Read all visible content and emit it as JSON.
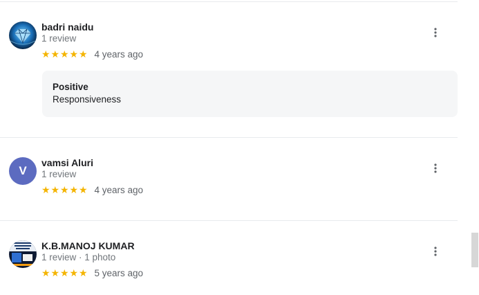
{
  "reviews": [
    {
      "name": "badri naidu",
      "meta": "1 review",
      "rating": 5,
      "time": "4 years ago",
      "avatar_type": "photo",
      "highlight": {
        "title": "Positive",
        "value": "Responsiveness"
      }
    },
    {
      "name": "vamsi Aluri",
      "meta": "1 review",
      "rating": 5,
      "time": "4 years ago",
      "avatar_type": "letter",
      "avatar_letter": "V"
    },
    {
      "name": "K.B.MANOJ KUMAR",
      "meta": "1 review · 1 photo",
      "rating": 5,
      "time": "5 years ago",
      "avatar_type": "photo"
    }
  ],
  "icons": {
    "star": "star-icon",
    "more": "more-vert-icon"
  },
  "colors": {
    "star": "#f4b400",
    "letter_avatar": "#5c6bc0",
    "highlight_bg": "#f5f6f7",
    "divider": "#e8eaed"
  }
}
